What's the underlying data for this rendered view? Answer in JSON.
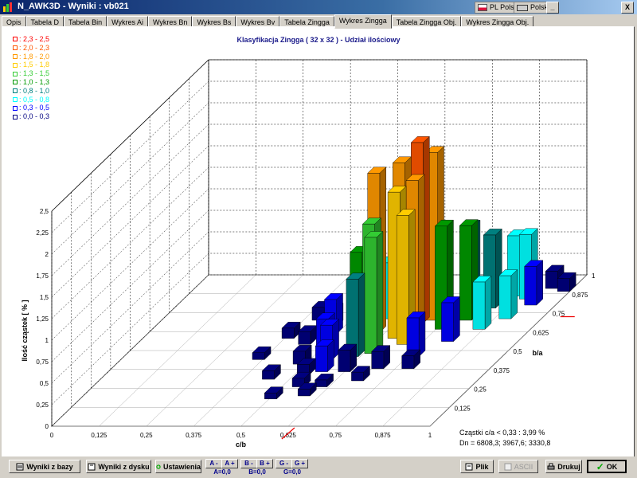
{
  "window": {
    "title": "N_AWK3D - Wyniki : vb021",
    "lang1": "PL Polski",
    "lang2": "Polski",
    "minimize": "_",
    "close": "X"
  },
  "tabs": [
    "Opis",
    "Tabela D",
    "Tabela Bin",
    "Wykres Ai",
    "Wykres Bn",
    "Wykres Bs",
    "Wykres Bv",
    "Tabela Zingga",
    "Wykres Zingga",
    "Tabela Zingga Obj.",
    "Wykres Zingga Obj."
  ],
  "active_tab": "Wykres Zingga",
  "legend": [
    {
      "label": ": 2,3 - 2,5",
      "color": "#ff0000"
    },
    {
      "label": ": 2,0 - 2,3",
      "color": "#ff5500"
    },
    {
      "label": ": 1,8 - 2,0",
      "color": "#ff9900"
    },
    {
      "label": ": 1,5 - 1,8",
      "color": "#ffcc00"
    },
    {
      "label": ": 1,3 - 1,5",
      "color": "#33cc33"
    },
    {
      "label": ": 1,0 - 1,3",
      "color": "#009900"
    },
    {
      "label": ": 0,8 - 1,0",
      "color": "#008080"
    },
    {
      "label": ": 0,5 - 0,8",
      "color": "#00ffff"
    },
    {
      "label": ": 0,3 - 0,5",
      "color": "#0000ff"
    },
    {
      "label": ": 0,0 - 0,3",
      "color": "#000080"
    }
  ],
  "chart_data": {
    "type": "bar3d",
    "title": "Klasyfikacja Zingga  ( 32 x 32 ) - Udział ilościowy",
    "xlabel": "c/b",
    "ylabel": "Ilość cząstek [ % ]",
    "zlabel": "b/a",
    "x_ticks": [
      "0",
      "0,125",
      "0,25",
      "0,375",
      "0,5",
      "0,625",
      "0,75",
      "0,875",
      "1"
    ],
    "z_ticks": [
      "0",
      "0,125",
      "0,25",
      "0,375",
      "0,5",
      "0,625",
      "0,75",
      "0,875",
      "1"
    ],
    "y_ticks": [
      "0",
      "0,25",
      "0,5",
      "0,75",
      "1",
      "1,25",
      "1,5",
      "1,75",
      "2",
      "2,25",
      "2,5"
    ],
    "xlim": [
      0,
      1
    ],
    "zlim": [
      0,
      1
    ],
    "ylim": [
      0,
      2.5
    ],
    "grid": true,
    "bars": [
      {
        "x": 0.61,
        "z": 0.66,
        "h": 1.85
      },
      {
        "x": 0.66,
        "z": 0.7,
        "h": 1.9
      },
      {
        "x": 0.7,
        "z": 0.72,
        "h": 2.1
      },
      {
        "x": 0.73,
        "z": 0.74,
        "h": 1.95
      },
      {
        "x": 0.68,
        "z": 0.62,
        "h": 1.7
      },
      {
        "x": 0.72,
        "z": 0.64,
        "h": 1.8
      },
      {
        "x": 0.63,
        "z": 0.58,
        "h": 1.4
      },
      {
        "x": 0.66,
        "z": 0.52,
        "h": 1.35
      },
      {
        "x": 0.72,
        "z": 0.58,
        "h": 1.5
      },
      {
        "x": 0.78,
        "z": 0.68,
        "h": 1.2
      },
      {
        "x": 0.82,
        "z": 0.74,
        "h": 1.1
      },
      {
        "x": 0.58,
        "z": 0.62,
        "h": 1.0
      },
      {
        "x": 0.78,
        "z": 0.85,
        "h": 0.9
      },
      {
        "x": 0.85,
        "z": 0.82,
        "h": 0.85
      },
      {
        "x": 0.88,
        "z": 0.9,
        "h": 0.7
      },
      {
        "x": 0.92,
        "z": 0.88,
        "h": 0.75
      },
      {
        "x": 0.62,
        "z": 0.5,
        "h": 0.9
      },
      {
        "x": 0.78,
        "z": 0.5,
        "h": 0.45
      },
      {
        "x": 0.55,
        "z": 0.7,
        "h": 0.55
      },
      {
        "x": 0.6,
        "z": 0.75,
        "h": 0.65
      },
      {
        "x": 0.83,
        "z": 0.6,
        "h": 0.45
      },
      {
        "x": 0.88,
        "z": 0.68,
        "h": 0.55
      },
      {
        "x": 0.92,
        "z": 0.75,
        "h": 0.5
      },
      {
        "x": 0.95,
        "z": 0.84,
        "h": 0.45
      },
      {
        "x": 0.5,
        "z": 0.65,
        "h": 0.4
      },
      {
        "x": 0.52,
        "z": 0.55,
        "h": 0.35
      },
      {
        "x": 0.56,
        "z": 0.48,
        "h": 0.4
      },
      {
        "x": 0.58,
        "z": 0.4,
        "h": 0.3
      },
      {
        "x": 0.64,
        "z": 0.4,
        "h": 0.25
      },
      {
        "x": 0.72,
        "z": 0.42,
        "h": 0.2
      },
      {
        "x": 0.8,
        "z": 0.42,
        "h": 0.15
      },
      {
        "x": 0.96,
        "z": 0.95,
        "h": 0.2
      },
      {
        "x": 1.0,
        "z": 0.93,
        "h": 0.15
      },
      {
        "x": 0.46,
        "z": 0.58,
        "h": 0.15
      },
      {
        "x": 0.48,
        "z": 0.7,
        "h": 0.2
      },
      {
        "x": 0.43,
        "z": 0.74,
        "h": 0.15
      },
      {
        "x": 0.4,
        "z": 0.62,
        "h": 0.12
      },
      {
        "x": 0.5,
        "z": 0.45,
        "h": 0.15
      },
      {
        "x": 0.54,
        "z": 0.38,
        "h": 0.12
      },
      {
        "x": 0.46,
        "z": 0.35,
        "h": 0.1
      },
      {
        "x": 0.56,
        "z": 0.3,
        "h": 0.1
      },
      {
        "x": 0.62,
        "z": 0.3,
        "h": 0.08
      },
      {
        "x": 0.7,
        "z": 0.34,
        "h": 0.1
      },
      {
        "x": 0.38,
        "z": 0.48,
        "h": 0.08
      },
      {
        "x": 0.6,
        "z": 0.24,
        "h": 0.08
      },
      {
        "x": 0.52,
        "z": 0.22,
        "h": 0.07
      }
    ],
    "color_thresholds": [
      2.3,
      2.0,
      1.8,
      1.5,
      1.3,
      1.0,
      0.8,
      0.5,
      0.3,
      0.0
    ]
  },
  "stats": {
    "line1": "Cząstki c/a < 0,33 : 3,99 %",
    "line2": "Dn = 6808,3; 3967,6; 3330,8"
  },
  "toolbar": {
    "wyniki_z_bazy": "Wyniki z bazy",
    "wyniki_z_dysku": "Wyniki z dysku",
    "ustawienia": "Ustawienia",
    "a_minus": "A -",
    "a_plus": "A +",
    "a_val": "A=0,0",
    "b_minus": "B -",
    "b_plus": "B +",
    "b_val": "B=0,0",
    "g_minus": "G -",
    "g_plus": "G +",
    "g_val": "G=0,0",
    "plik": "Plik",
    "ascii": "ASCII",
    "drukuj": "Drukuj",
    "ok": "OK"
  }
}
